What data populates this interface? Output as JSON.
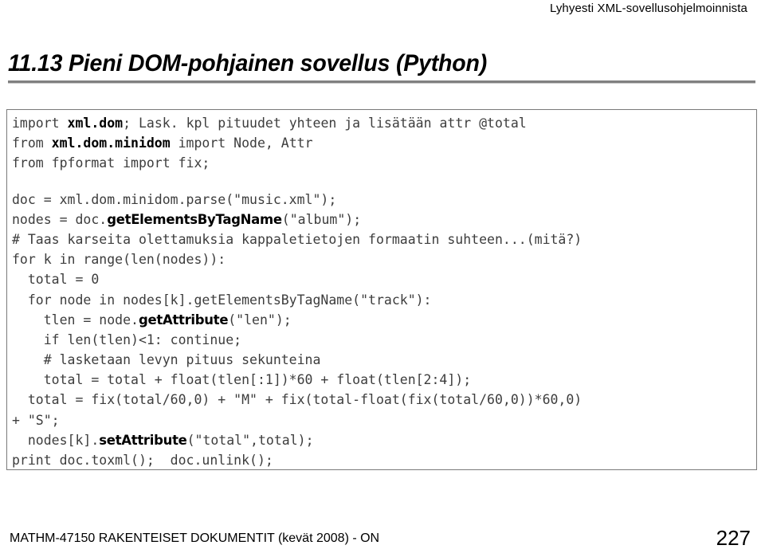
{
  "header": {
    "text": "Lyhyesti XML-sovellusohjelmoinnista"
  },
  "title": {
    "text": "11.13 Pieni DOM-pohjainen sovellus (Python)"
  },
  "code": {
    "language": "Python",
    "lines": [
      {
        "id": "line-1",
        "pre": "import ",
        "bold": "xml.dom",
        "bold_style": "mono",
        "post": "; Lask. kpl pituudet yhteen ja lisätään attr @total"
      },
      {
        "id": "line-2",
        "pre": "from ",
        "bold": "xml.dom.minidom",
        "bold_style": "mono",
        "post": " import Node, Attr"
      },
      {
        "id": "line-3",
        "pre": "from fpformat import fix;",
        "bold": "",
        "bold_style": "",
        "post": ""
      },
      {
        "id": "line-4",
        "pre": "",
        "bold": "",
        "bold_style": "",
        "post": ""
      },
      {
        "id": "line-5",
        "pre": "doc = xml.dom.minidom.parse(\"music.xml\");",
        "bold": "",
        "bold_style": "",
        "post": ""
      },
      {
        "id": "line-6",
        "pre": "nodes = doc.",
        "bold": "getElementsByTagName",
        "bold_style": "sans",
        "post": "(\"album\");"
      },
      {
        "id": "line-7",
        "pre": "# Taas karseita olettamuksia kappaletietojen formaatin suhteen...(mitä?)",
        "bold": "",
        "bold_style": "",
        "post": ""
      },
      {
        "id": "line-8",
        "pre": "for k in range(len(nodes)):",
        "bold": "",
        "bold_style": "",
        "post": ""
      },
      {
        "id": "line-9",
        "pre": "  total = 0",
        "bold": "",
        "bold_style": "",
        "post": ""
      },
      {
        "id": "line-10",
        "pre": "  for node in nodes[k].getElementsByTagName(\"track\"):",
        "bold": "",
        "bold_style": "",
        "post": ""
      },
      {
        "id": "line-11",
        "pre": "    tlen = node.",
        "bold": "getAttribute",
        "bold_style": "sans",
        "post": "(\"len\");"
      },
      {
        "id": "line-12",
        "pre": "    if len(tlen)<1: continue;",
        "bold": "",
        "bold_style": "",
        "post": ""
      },
      {
        "id": "line-13",
        "pre": "    # lasketaan levyn pituus sekunteina",
        "bold": "",
        "bold_style": "",
        "post": ""
      },
      {
        "id": "line-14",
        "pre": "    total = total + float(tlen[:1])*60 + float(tlen[2:4]);",
        "bold": "",
        "bold_style": "",
        "post": ""
      },
      {
        "id": "line-15",
        "pre": "  total = fix(total/60,0) + \"M\" + fix(total-float(fix(total/60,0))*60,0)",
        "bold": "",
        "bold_style": "",
        "post": ""
      },
      {
        "id": "line-16",
        "pre": "+ \"S\";",
        "bold": "",
        "bold_style": "",
        "post": ""
      },
      {
        "id": "line-17",
        "pre": "  nodes[k].",
        "bold": "setAttribute",
        "bold_style": "sans",
        "post": "(\"total\",total);"
      },
      {
        "id": "line-18",
        "pre": "print doc.toxml();  doc.unlink();",
        "bold": "",
        "bold_style": "",
        "post": ""
      }
    ]
  },
  "footer": {
    "course": "MATHM-47150 RAKENTEISET DOKUMENTIT (kevät 2008) - ON",
    "page_number": "227"
  },
  "colors": {
    "rule": "#808080",
    "code_border": "#7a7a7a",
    "code_text": "#3d3d3d",
    "bold_text": "#000000",
    "background": "#ffffff"
  }
}
